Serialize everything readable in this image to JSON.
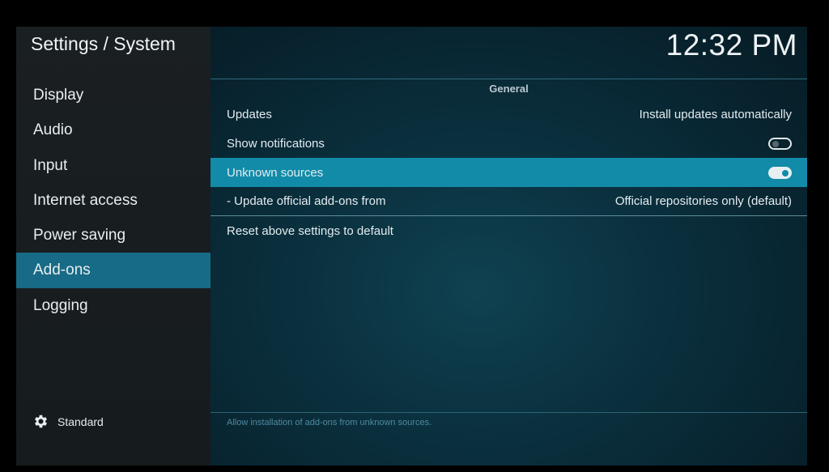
{
  "header": {
    "title": "Settings / System",
    "clock": "12:32 PM"
  },
  "sidebar": {
    "items": [
      {
        "label": "Display"
      },
      {
        "label": "Audio"
      },
      {
        "label": "Input"
      },
      {
        "label": "Internet access"
      },
      {
        "label": "Power saving"
      },
      {
        "label": "Add-ons",
        "active": true
      },
      {
        "label": "Logging"
      }
    ],
    "settings_level": {
      "icon": "gear-icon",
      "label": "Standard"
    }
  },
  "main": {
    "section_header": "General",
    "settings": [
      {
        "label": "Updates",
        "value": "Install updates automatically"
      },
      {
        "label": "Show notifications",
        "toggle": "off"
      },
      {
        "label": "Unknown sources",
        "toggle": "on",
        "focused": true
      },
      {
        "label": "- Update official add-ons from",
        "value": "Official repositories only (default)"
      },
      {
        "label": "Reset above settings to default"
      }
    ],
    "help_text": "Allow installation of add-ons from unknown sources."
  },
  "colors": {
    "accent_active": "#186b86",
    "accent_focus": "#128ba9"
  }
}
